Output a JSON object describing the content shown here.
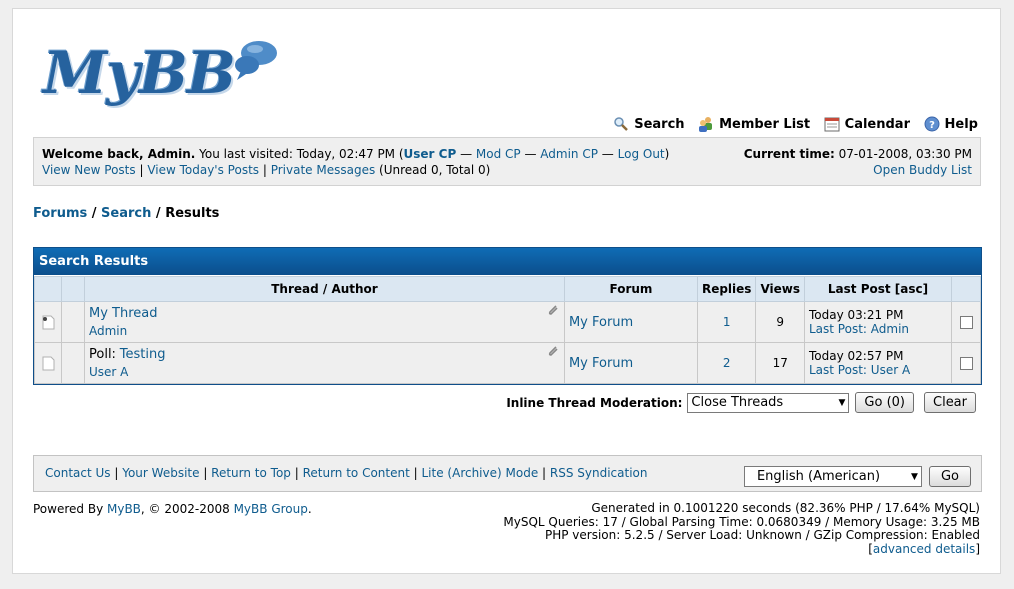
{
  "logo": {
    "text": "MyBB"
  },
  "menu": {
    "search": "Search",
    "member_list": "Member List",
    "calendar": "Calendar",
    "help": "Help"
  },
  "panel": {
    "welcome": "Welcome back, Admin.",
    "last_visit": " You last visited: Today, 02:47 PM (",
    "user_cp": "User CP",
    "dash": " — ",
    "mod_cp": "Mod CP",
    "admin_cp": "Admin CP",
    "log_out": "Log Out",
    "close_paren": ")",
    "view_new_posts": "View New Posts",
    "pipe": " | ",
    "view_todays_posts": "View Today's Posts",
    "private_messages": "Private Messages",
    "pm_counts": " (Unread 0, Total 0)",
    "current_time_label": "Current time:",
    "current_time": " 07-01-2008, 03:30 PM",
    "open_buddy_list": "Open Buddy List"
  },
  "breadcrumb": {
    "forums": "Forums",
    "sep": " / ",
    "search": "Search",
    "results": "Results"
  },
  "results": {
    "header": "Search Results",
    "columns": {
      "thread_author": "Thread / Author",
      "forum": "Forum",
      "replies": "Replies",
      "views": "Views",
      "last_post": "Last Post [asc]"
    },
    "rows": [
      {
        "prefix": "",
        "title": "My Thread",
        "author": "Admin",
        "forum": "My Forum",
        "replies": "1",
        "views": "9",
        "last_time": "Today 03:21 PM",
        "last_label": "Last Post:",
        "last_user": "Admin"
      },
      {
        "prefix": "Poll:",
        "title": "Testing",
        "author": "User A",
        "forum": "My Forum",
        "replies": "2",
        "views": "17",
        "last_time": "Today 02:57 PM",
        "last_label": "Last Post:",
        "last_user": "User A"
      }
    ]
  },
  "moderation": {
    "label": "Inline Thread Moderation:",
    "selected": "Close Threads",
    "go": "Go (0)",
    "clear": "Clear"
  },
  "footer": {
    "links": [
      "Contact Us",
      "Your Website",
      "Return to Top",
      "Return to Content",
      "Lite (Archive) Mode",
      "RSS Syndication"
    ],
    "language": "English (American)",
    "go": "Go"
  },
  "powered": {
    "prefix": "Powered By ",
    "mybb": "MyBB",
    "copy": ", © 2002-2008 ",
    "group": "MyBB Group",
    "dot": "."
  },
  "debug": {
    "line1": "Generated in 0.1001220 seconds (82.36% PHP / 17.64% MySQL)",
    "line2": "MySQL Queries: 17 / Global Parsing Time: 0.0680349 / Memory Usage: 3.25 MB",
    "line3": "PHP version: 5.2.5 / Server Load: Unknown / GZip Compression: Enabled",
    "open_bracket": "[",
    "advanced": "advanced details",
    "close_bracket": "]"
  },
  "colors": {
    "accent": "#0f5c8e",
    "table_header": "#0b4e8c",
    "panel_bg": "#efefef"
  }
}
